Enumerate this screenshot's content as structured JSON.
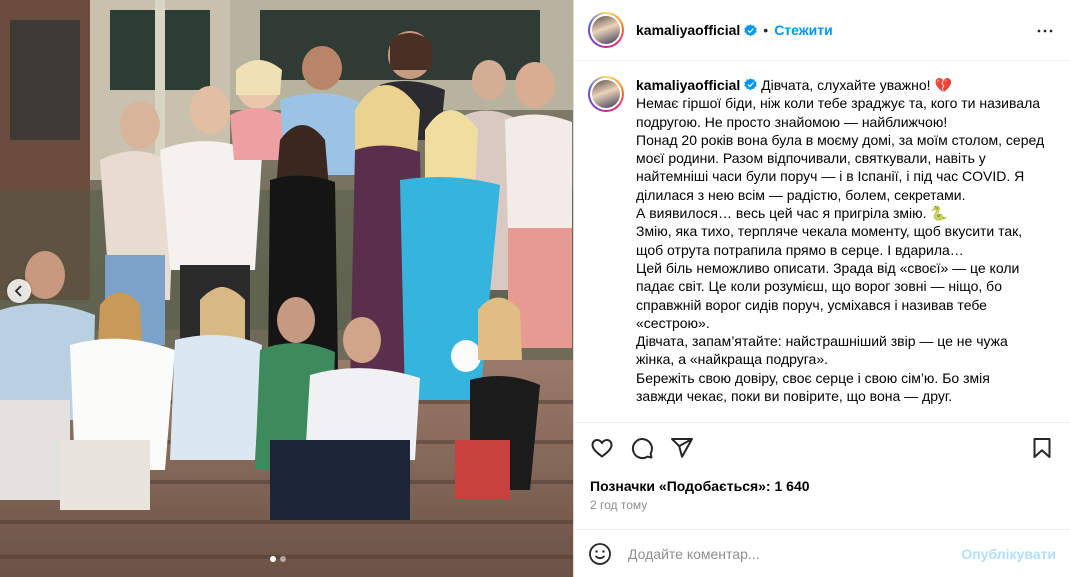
{
  "post": {
    "username": "kamaliyaofficial",
    "separator": "•",
    "follow_label": "Стежити",
    "more_icon": "more-horizontal-icon"
  },
  "caption": {
    "username": "kamaliyaofficial",
    "first_line_text": " Дівчата, слухайте уважно! 💔",
    "lines": [
      "Немає гіршої біди, ніж коли тебе зраджує та, кого ти називала",
      "подругою. Не просто знайомою — найближчою!",
      "Понад 20 років вона була в моєму домі, за моїм столом, серед",
      "моєї родини. Разом відпочивали, святкували, навіть у",
      "найтемніші часи були поруч — і в Іспанії, і під час COVID. Я",
      "ділилася з нею всім — радістю, болем, секретами.",
      "А виявилося… весь цей час я пригріла змію. 🐍",
      "Змію, яка тихо, терпляче чекала моменту, щоб вкусити так,",
      "щоб отрута потрапила прямо в серце. І вдарила…",
      "Цей біль неможливо описати. Зрада від «своєї» — це коли",
      "падає світ. Це коли розумієш, що ворог зовні — ніщо, бо",
      "справжній ворог сидів поруч, усміхався і називав тебе",
      "«сестрою».",
      "Дівчата, запам’ятайте: найстрашніший звір — це не чужа",
      "жінка, а «найкраща подруга».",
      "Бережіть свою довіру, своє серце і свою сім’ю. Бо змія",
      "завжди чекає, поки ви повірите, що вона — друг."
    ]
  },
  "likes_text": "Позначки «Подобається»: 1 640",
  "time_ago": "2 год тому",
  "comment": {
    "placeholder": "Додайте коментар...",
    "publish_label": "Опублікувати"
  },
  "carousel": {
    "dot_count": 2,
    "active_index": 0
  },
  "colors": {
    "accent": "#0095f6",
    "publish_disabled": "#b2dffc",
    "muted": "#8e8e8e",
    "border": "#dbdbdb"
  }
}
